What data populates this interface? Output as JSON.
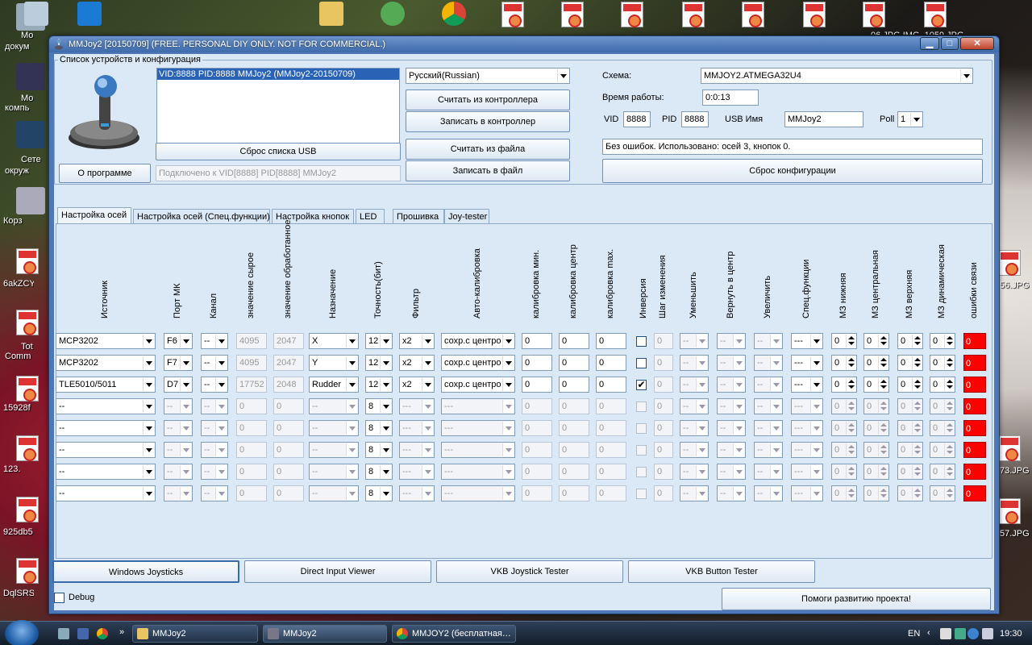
{
  "desktop": {
    "left_labels": [
      "Мо",
      "докум",
      "Мо",
      "компь",
      "Сете",
      "окруж",
      "Корз",
      "6akZCY",
      "Tot",
      "Comm",
      "15928f",
      "123.",
      "925db5",
      "DqlSRS"
    ],
    "right_labels": [
      "56.JPG",
      "73.JPG",
      "57.JPG"
    ],
    "top_fragment": "06 JPG IMG_1059.JPG"
  },
  "window": {
    "title": "MMJoy2 [20150709] (FREE. PERSONAL DIY ONLY. NOT FOR COMMERCIAL.)",
    "minimize": "▁",
    "maximize": "□",
    "close": "✕"
  },
  "devices": {
    "group_title": "Список устройств и конфигурация",
    "list": [
      "VID:8888 PID:8888 MMJoy2 (MMJoy2-20150709)"
    ],
    "reset_usb": "Сброс списка USB",
    "about": "О программе",
    "connected": "Подключено к VID[8888] PID[8888] MMJoy2",
    "language": "Русский(Russian)",
    "read_controller": "Считать из контроллера",
    "write_controller": "Записать в контроллер",
    "read_file": "Считать из файла",
    "write_file": "Записать в файл",
    "scheme_label": "Схема:",
    "scheme_value": "MMJOY2.ATMEGA32U4",
    "worktime_label": "Время работы:",
    "worktime_value": "0:0:13",
    "vid_label": "VID",
    "vid_value": "8888",
    "pid_label": "PID",
    "pid_value": "8888",
    "usb_name_label": "USB Имя",
    "usb_name_value": "MMJoy2",
    "poll_label": "Poll",
    "poll_value": "1",
    "status": "Без ошибок. Использовано: осей  3, кнопок  0.",
    "reset_config": "Сброс конфигурации"
  },
  "tabs": [
    "Настройка осей",
    "Настройка осей (Спец.функции)",
    "Настройка кнопок",
    "LED",
    "Прошивка",
    "Joy-tester"
  ],
  "columns": [
    "Источник",
    "Порт МК",
    "Канал",
    "значение сырое",
    "значение обработанное",
    "Назначение",
    "Точность(бит)",
    "Фильтр",
    "Авто-калибровка",
    "калибровка мин.",
    "калибровка центр",
    "калибровка max.",
    "Инверсия",
    "Шаг изменения",
    "Уменьшить",
    "Вернуть в центр",
    "Увеличить",
    "Спец.функции",
    "МЗ нижняя",
    "МЗ центральная",
    "МЗ верхняя",
    "МЗ динамическая",
    "ошибки связи"
  ],
  "rows": [
    {
      "source": "MCP3202",
      "port": "F6",
      "channel": "--",
      "raw": "4095",
      "processed": "2047",
      "assign": "X",
      "bits": "12",
      "filter": "x2",
      "autocal": "сохр.с центро",
      "cmin": "0",
      "ccenter": "0",
      "cmax": "0",
      "invert": "",
      "step": "0",
      "dec": "--",
      "center": "--",
      "inc": "--",
      "spec": "---",
      "dzl": "0",
      "dzc": "0",
      "dzh": "0",
      "dzd": "0",
      "err": "0",
      "active": true
    },
    {
      "source": "MCP3202",
      "port": "F7",
      "channel": "--",
      "raw": "4095",
      "processed": "2047",
      "assign": "Y",
      "bits": "12",
      "filter": "x2",
      "autocal": "сохр.с центро",
      "cmin": "0",
      "ccenter": "0",
      "cmax": "0",
      "invert": "",
      "step": "0",
      "dec": "--",
      "center": "--",
      "inc": "--",
      "spec": "---",
      "dzl": "0",
      "dzc": "0",
      "dzh": "0",
      "dzd": "0",
      "err": "0",
      "active": true
    },
    {
      "source": "TLE5010/5011",
      "port": "D7",
      "channel": "--",
      "raw": "17752",
      "processed": "2048",
      "assign": "Rudder",
      "bits": "12",
      "filter": "x2",
      "autocal": "сохр.с центро",
      "cmin": "0",
      "ccenter": "0",
      "cmax": "0",
      "invert": "✔",
      "step": "0",
      "dec": "--",
      "center": "--",
      "inc": "--",
      "spec": "---",
      "dzl": "0",
      "dzc": "0",
      "dzh": "0",
      "dzd": "0",
      "err": "0",
      "active": true
    },
    {
      "source": "--",
      "port": "--",
      "channel": "--",
      "raw": "0",
      "processed": "0",
      "assign": "--",
      "bits": "8",
      "filter": "---",
      "autocal": "---",
      "cmin": "0",
      "ccenter": "0",
      "cmax": "0",
      "invert": "",
      "step": "0",
      "dec": "--",
      "center": "--",
      "inc": "--",
      "spec": "---",
      "dzl": "0",
      "dzc": "0",
      "dzh": "0",
      "dzd": "0",
      "err": "0",
      "active": false
    },
    {
      "source": "--",
      "port": "--",
      "channel": "--",
      "raw": "0",
      "processed": "0",
      "assign": "--",
      "bits": "8",
      "filter": "---",
      "autocal": "---",
      "cmin": "0",
      "ccenter": "0",
      "cmax": "0",
      "invert": "",
      "step": "0",
      "dec": "--",
      "center": "--",
      "inc": "--",
      "spec": "---",
      "dzl": "0",
      "dzc": "0",
      "dzh": "0",
      "dzd": "0",
      "err": "0",
      "active": false
    },
    {
      "source": "--",
      "port": "--",
      "channel": "--",
      "raw": "0",
      "processed": "0",
      "assign": "--",
      "bits": "8",
      "filter": "---",
      "autocal": "---",
      "cmin": "0",
      "ccenter": "0",
      "cmax": "0",
      "invert": "",
      "step": "0",
      "dec": "--",
      "center": "--",
      "inc": "--",
      "spec": "---",
      "dzl": "0",
      "dzc": "0",
      "dzh": "0",
      "dzd": "0",
      "err": "0",
      "active": false
    },
    {
      "source": "--",
      "port": "--",
      "channel": "--",
      "raw": "0",
      "processed": "0",
      "assign": "--",
      "bits": "8",
      "filter": "---",
      "autocal": "---",
      "cmin": "0",
      "ccenter": "0",
      "cmax": "0",
      "invert": "",
      "step": "0",
      "dec": "--",
      "center": "--",
      "inc": "--",
      "spec": "---",
      "dzl": "0",
      "dzc": "0",
      "dzh": "0",
      "dzd": "0",
      "err": "0",
      "active": false
    },
    {
      "source": "--",
      "port": "--",
      "channel": "--",
      "raw": "0",
      "processed": "0",
      "assign": "--",
      "bits": "8",
      "filter": "---",
      "autocal": "---",
      "cmin": "0",
      "ccenter": "0",
      "cmax": "0",
      "invert": "",
      "step": "0",
      "dec": "--",
      "center": "--",
      "inc": "--",
      "spec": "---",
      "dzl": "0",
      "dzc": "0",
      "dzh": "0",
      "dzd": "0",
      "err": "0",
      "active": false
    }
  ],
  "bottom": {
    "win_joysticks": "Windows Joysticks",
    "dinput_viewer": "Direct Input Viewer",
    "vkb_joystick": "VKB Joystick Tester",
    "vkb_button": "VKB Button Tester",
    "debug": "Debug",
    "donate": "Помоги развитию проекта!"
  },
  "taskbar": {
    "tasks": [
      "MMJoy2",
      "MMJoy2",
      "MMJOY2 (бесплатная…"
    ],
    "lang": "EN",
    "time": "19:30"
  }
}
